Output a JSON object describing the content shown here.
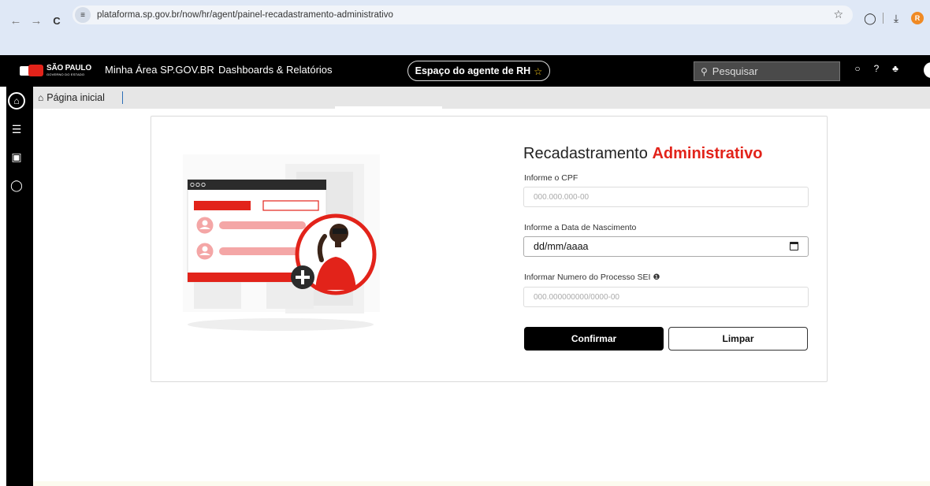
{
  "browser": {
    "url": "plataforma.sp.gov.br/now/hr/agent/painel-recadastramento-administrativo",
    "profile_initial": "R"
  },
  "header": {
    "logo_line1": "SÃO PAULO",
    "logo_line2": "GOVERNO DO ESTADO",
    "nav": [
      "Minha Área SP.GOV.BR",
      "Dashboards & Relatórios"
    ],
    "workspace_label": "Espaço do agente de RH",
    "search_placeholder": "Pesquisar"
  },
  "tabs": {
    "home_label": "Página inicial"
  },
  "form": {
    "title_plain": "Recadastramento",
    "title_highlight": "Administrativo",
    "fields": [
      {
        "label": "Informe o CPF",
        "placeholder": "000.000.000-00"
      },
      {
        "label": "Informe a Data de Nascimento",
        "value": "dd/mm/aaaa"
      },
      {
        "label": "Informar Numero do Processo SEI",
        "placeholder": "000.000000000/0000-00"
      }
    ],
    "confirm_label": "Confirmar",
    "clear_label": "Limpar"
  },
  "colors": {
    "brand_red": "#e2231a",
    "header_bg": "#000000",
    "browser_bg": "#dfe8f6"
  }
}
